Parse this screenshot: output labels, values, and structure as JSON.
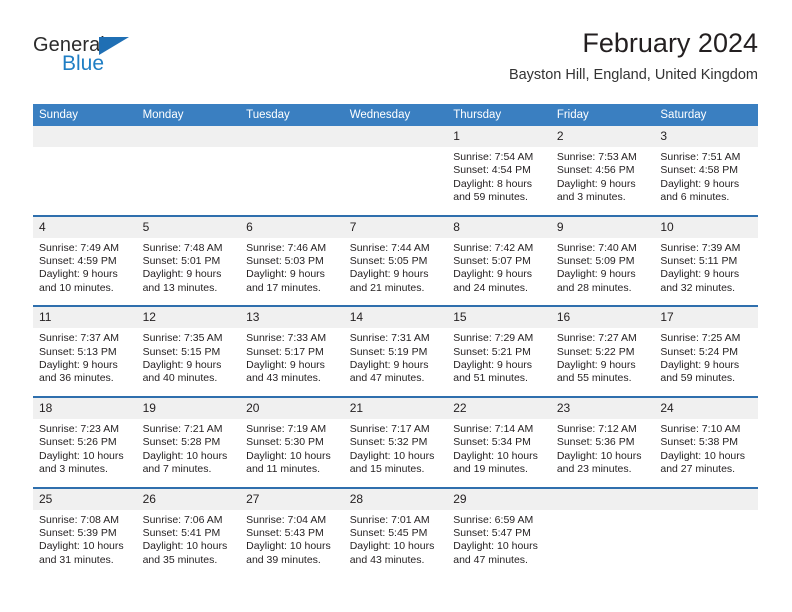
{
  "brand": {
    "name_top": "General",
    "name_bottom": "Blue",
    "triangle_color": "#1f6fb4",
    "blue_color": "#1f7ec4"
  },
  "header": {
    "title": "February 2024",
    "subtitle": "Bayston Hill, England, United Kingdom"
  },
  "theme": {
    "header_bg": "#3a7fc1",
    "row_divider": "#2f6fad",
    "daynum_bg": "#f0f0f0"
  },
  "calendar": {
    "weekdays": [
      "Sunday",
      "Monday",
      "Tuesday",
      "Wednesday",
      "Thursday",
      "Friday",
      "Saturday"
    ],
    "weeks": [
      [
        {
          "day": "",
          "lines": []
        },
        {
          "day": "",
          "lines": []
        },
        {
          "day": "",
          "lines": []
        },
        {
          "day": "",
          "lines": []
        },
        {
          "day": "1",
          "lines": [
            "Sunrise: 7:54 AM",
            "Sunset: 4:54 PM",
            "Daylight: 8 hours",
            "and 59 minutes."
          ]
        },
        {
          "day": "2",
          "lines": [
            "Sunrise: 7:53 AM",
            "Sunset: 4:56 PM",
            "Daylight: 9 hours",
            "and 3 minutes."
          ]
        },
        {
          "day": "3",
          "lines": [
            "Sunrise: 7:51 AM",
            "Sunset: 4:58 PM",
            "Daylight: 9 hours",
            "and 6 minutes."
          ]
        }
      ],
      [
        {
          "day": "4",
          "lines": [
            "Sunrise: 7:49 AM",
            "Sunset: 4:59 PM",
            "Daylight: 9 hours",
            "and 10 minutes."
          ]
        },
        {
          "day": "5",
          "lines": [
            "Sunrise: 7:48 AM",
            "Sunset: 5:01 PM",
            "Daylight: 9 hours",
            "and 13 minutes."
          ]
        },
        {
          "day": "6",
          "lines": [
            "Sunrise: 7:46 AM",
            "Sunset: 5:03 PM",
            "Daylight: 9 hours",
            "and 17 minutes."
          ]
        },
        {
          "day": "7",
          "lines": [
            "Sunrise: 7:44 AM",
            "Sunset: 5:05 PM",
            "Daylight: 9 hours",
            "and 21 minutes."
          ]
        },
        {
          "day": "8",
          "lines": [
            "Sunrise: 7:42 AM",
            "Sunset: 5:07 PM",
            "Daylight: 9 hours",
            "and 24 minutes."
          ]
        },
        {
          "day": "9",
          "lines": [
            "Sunrise: 7:40 AM",
            "Sunset: 5:09 PM",
            "Daylight: 9 hours",
            "and 28 minutes."
          ]
        },
        {
          "day": "10",
          "lines": [
            "Sunrise: 7:39 AM",
            "Sunset: 5:11 PM",
            "Daylight: 9 hours",
            "and 32 minutes."
          ]
        }
      ],
      [
        {
          "day": "11",
          "lines": [
            "Sunrise: 7:37 AM",
            "Sunset: 5:13 PM",
            "Daylight: 9 hours",
            "and 36 minutes."
          ]
        },
        {
          "day": "12",
          "lines": [
            "Sunrise: 7:35 AM",
            "Sunset: 5:15 PM",
            "Daylight: 9 hours",
            "and 40 minutes."
          ]
        },
        {
          "day": "13",
          "lines": [
            "Sunrise: 7:33 AM",
            "Sunset: 5:17 PM",
            "Daylight: 9 hours",
            "and 43 minutes."
          ]
        },
        {
          "day": "14",
          "lines": [
            "Sunrise: 7:31 AM",
            "Sunset: 5:19 PM",
            "Daylight: 9 hours",
            "and 47 minutes."
          ]
        },
        {
          "day": "15",
          "lines": [
            "Sunrise: 7:29 AM",
            "Sunset: 5:21 PM",
            "Daylight: 9 hours",
            "and 51 minutes."
          ]
        },
        {
          "day": "16",
          "lines": [
            "Sunrise: 7:27 AM",
            "Sunset: 5:22 PM",
            "Daylight: 9 hours",
            "and 55 minutes."
          ]
        },
        {
          "day": "17",
          "lines": [
            "Sunrise: 7:25 AM",
            "Sunset: 5:24 PM",
            "Daylight: 9 hours",
            "and 59 minutes."
          ]
        }
      ],
      [
        {
          "day": "18",
          "lines": [
            "Sunrise: 7:23 AM",
            "Sunset: 5:26 PM",
            "Daylight: 10 hours",
            "and 3 minutes."
          ]
        },
        {
          "day": "19",
          "lines": [
            "Sunrise: 7:21 AM",
            "Sunset: 5:28 PM",
            "Daylight: 10 hours",
            "and 7 minutes."
          ]
        },
        {
          "day": "20",
          "lines": [
            "Sunrise: 7:19 AM",
            "Sunset: 5:30 PM",
            "Daylight: 10 hours",
            "and 11 minutes."
          ]
        },
        {
          "day": "21",
          "lines": [
            "Sunrise: 7:17 AM",
            "Sunset: 5:32 PM",
            "Daylight: 10 hours",
            "and 15 minutes."
          ]
        },
        {
          "day": "22",
          "lines": [
            "Sunrise: 7:14 AM",
            "Sunset: 5:34 PM",
            "Daylight: 10 hours",
            "and 19 minutes."
          ]
        },
        {
          "day": "23",
          "lines": [
            "Sunrise: 7:12 AM",
            "Sunset: 5:36 PM",
            "Daylight: 10 hours",
            "and 23 minutes."
          ]
        },
        {
          "day": "24",
          "lines": [
            "Sunrise: 7:10 AM",
            "Sunset: 5:38 PM",
            "Daylight: 10 hours",
            "and 27 minutes."
          ]
        }
      ],
      [
        {
          "day": "25",
          "lines": [
            "Sunrise: 7:08 AM",
            "Sunset: 5:39 PM",
            "Daylight: 10 hours",
            "and 31 minutes."
          ]
        },
        {
          "day": "26",
          "lines": [
            "Sunrise: 7:06 AM",
            "Sunset: 5:41 PM",
            "Daylight: 10 hours",
            "and 35 minutes."
          ]
        },
        {
          "day": "27",
          "lines": [
            "Sunrise: 7:04 AM",
            "Sunset: 5:43 PM",
            "Daylight: 10 hours",
            "and 39 minutes."
          ]
        },
        {
          "day": "28",
          "lines": [
            "Sunrise: 7:01 AM",
            "Sunset: 5:45 PM",
            "Daylight: 10 hours",
            "and 43 minutes."
          ]
        },
        {
          "day": "29",
          "lines": [
            "Sunrise: 6:59 AM",
            "Sunset: 5:47 PM",
            "Daylight: 10 hours",
            "and 47 minutes."
          ]
        },
        {
          "day": "",
          "lines": []
        },
        {
          "day": "",
          "lines": []
        }
      ]
    ]
  }
}
